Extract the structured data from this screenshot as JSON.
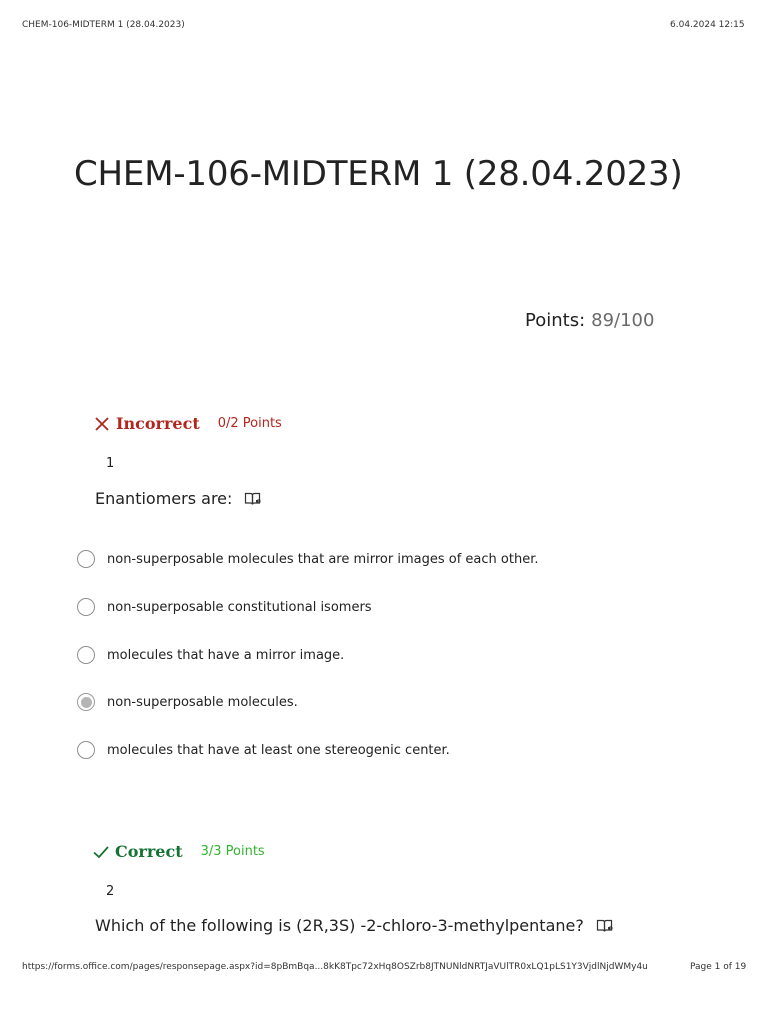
{
  "print_header": {
    "left": "CHEM-106-MIDTERM 1 (28.04.2023)",
    "right": "6.04.2024 12:15"
  },
  "page": {
    "title": "CHEM-106-MIDTERM 1 (28.04.2023)"
  },
  "score": {
    "label": "Points:",
    "value": "89/100"
  },
  "questions": [
    {
      "status": "Incorrect",
      "points": "0/2 Points",
      "number": "1",
      "text": "Enantiomers are:",
      "icon": "immersive-reader-icon",
      "options": [
        {
          "label": "non-superposable molecules that are mirror images of each other.",
          "selected": false
        },
        {
          "label": "non-superposable constitutional isomers",
          "selected": false
        },
        {
          "label": "molecules that have a mirror image.",
          "selected": false
        },
        {
          "label": "non-superposable molecules.",
          "selected": true
        },
        {
          "label": "molecules that have at least one stereogenic center.",
          "selected": false
        }
      ]
    },
    {
      "status": "Correct",
      "points": "3/3 Points",
      "number": "2",
      "text": "Which of the following is (2R,3S) -2-chloro-3-methylpentane?",
      "icon": "immersive-reader-icon"
    }
  ],
  "colors": {
    "incorrect": "#b3261e",
    "correct": "#137333",
    "correct_points": "#2fb52f"
  },
  "print_footer": {
    "left": "https://forms.office.com/pages/responsepage.aspx?id=8pBmBqa...8kK8Tpc72xHq8OSZrb8JTNUNldNRTJaVUlTR0xLQ1pLS1Y3VjdlNjdWMy4u",
    "right": "Page 1 of 19"
  }
}
